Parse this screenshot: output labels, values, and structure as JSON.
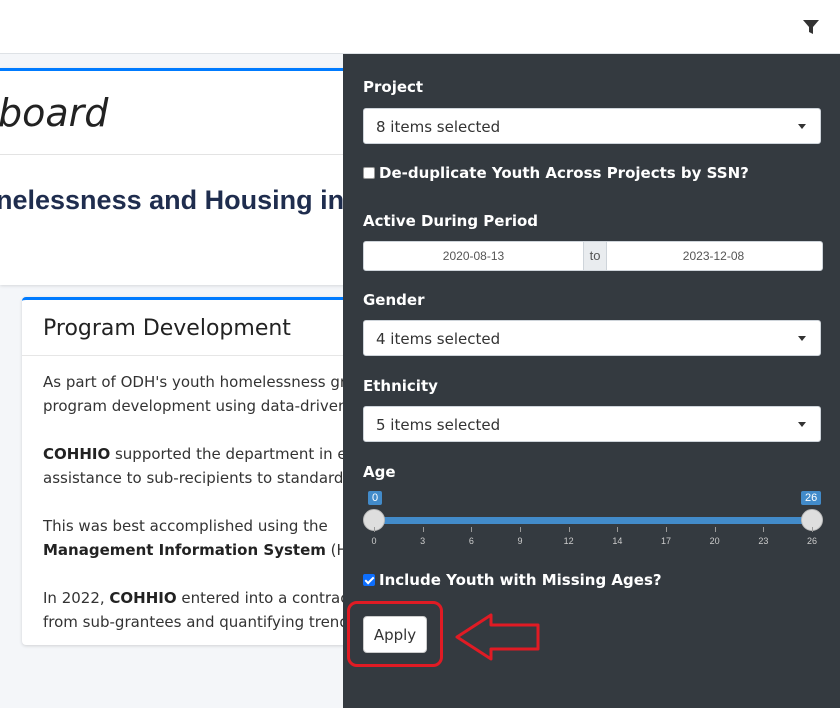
{
  "header": {
    "filter_icon": "filter-icon"
  },
  "dashboard": {
    "title": "board",
    "subtitle": "nelessness and Housing in C"
  },
  "program": {
    "heading": "Program Development",
    "p1_line1": "As part of ODH's youth homelessness gran",
    "p1_line2": "program development using data-driven app",
    "p2_bold": "COHHIO",
    "p2_line1_rest": " supported the department in est",
    "p2_line2": "assistance to sub-recipients to standardize da",
    "p3_line1": "This was best accomplished using the",
    "p3_bold": "Management Information System",
    "p3_line2_rest": " (HMIS).",
    "p4_pre": "In 2022, ",
    "p4_bold": "COHHIO",
    "p4_line1_rest": " entered into a contract wit",
    "p4_line2": "from sub-grantees and quantifying trends ac"
  },
  "filters": {
    "project_label": "Project",
    "project_value": "8 items selected",
    "dedup_label": "De-duplicate Youth Across Projects by SSN?",
    "dedup_checked": false,
    "active_label": "Active During Period",
    "date_start": "2020-08-13",
    "date_sep": "to",
    "date_end": "2023-12-08",
    "gender_label": "Gender",
    "gender_value": "4 items selected",
    "ethnicity_label": "Ethnicity",
    "ethnicity_value": "5 items selected",
    "age_label": "Age",
    "age_min": "0",
    "age_max": "26",
    "age_range": [
      0,
      26
    ],
    "age_ticks": [
      "0",
      "3",
      "6",
      "9",
      "12",
      "14",
      "17",
      "20",
      "23",
      "26"
    ],
    "missing_label": "Include Youth with Missing Ages?",
    "missing_checked": true,
    "apply_label": "Apply"
  },
  "colors": {
    "panel": "#343a40",
    "accent": "#428bca",
    "highlight": "#e01b24"
  }
}
